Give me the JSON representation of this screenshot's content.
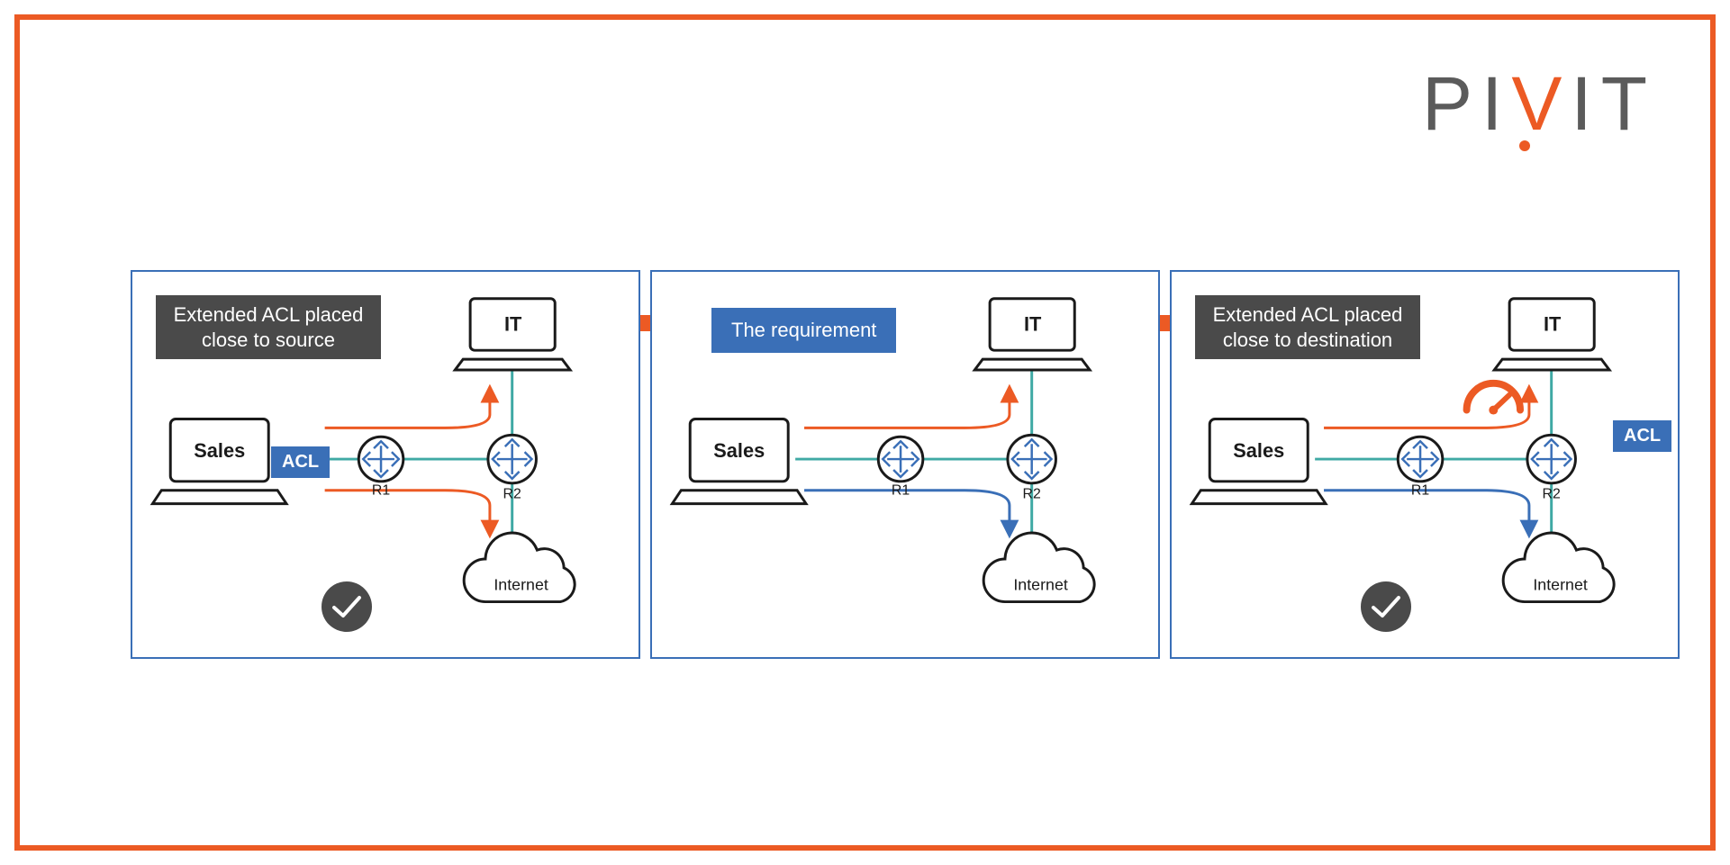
{
  "brand": {
    "name": "PIVIT",
    "p": "P",
    "i": "I",
    "v": "V",
    "i2": "I",
    "t": "T"
  },
  "panels": {
    "a": {
      "title": "Extended ACL placed close to source"
    },
    "b": {
      "requirement": "The requirement"
    },
    "c": {
      "title": "Extended ACL placed close to destination"
    }
  },
  "labels": {
    "sales": "Sales",
    "it": "IT",
    "internet": "Internet",
    "r1": "R1",
    "r2": "R2",
    "acl": "ACL"
  },
  "colors": {
    "frame": "#ec5a24",
    "panel_border": "#3a6fb7",
    "box_gray": "#4a4a4a",
    "box_blue": "#3a6fb7",
    "teal_line": "#3fa9a4",
    "orange_arrow": "#ec5a24",
    "blue_arrow": "#3a6fb7"
  },
  "diagram_meta": {
    "domain": "network-acl-placement",
    "nodes": [
      "Sales laptop",
      "R1 router",
      "R2 router",
      "IT laptop",
      "Internet cloud"
    ],
    "edges_physical": [
      [
        "Sales",
        "R1"
      ],
      [
        "R1",
        "R2"
      ],
      [
        "R2",
        "IT"
      ],
      [
        "R2",
        "Internet"
      ]
    ],
    "panel_a": {
      "acl_location": "between Sales and R1 (close to source)",
      "flows": [
        {
          "from": "Sales",
          "to": "IT",
          "color": "orange"
        },
        {
          "from": "Sales",
          "to": "Internet",
          "color": "orange"
        }
      ],
      "verdict": "shown with check mark"
    },
    "panel_b": {
      "acl_location": "none",
      "flows": [
        {
          "from": "Sales",
          "to": "IT",
          "color": "orange"
        },
        {
          "from": "Sales",
          "to": "Internet",
          "color": "blue"
        }
      ],
      "role": "baseline / requirement"
    },
    "panel_c": {
      "acl_location": "on R2 toward IT (close to destination)",
      "flows": [
        {
          "from": "Sales",
          "to": "IT",
          "color": "orange"
        },
        {
          "from": "Sales",
          "to": "Internet",
          "color": "blue"
        }
      ],
      "extra_icon": "speedometer / bandwidth-cost indicator",
      "verdict": "shown with check mark"
    }
  }
}
